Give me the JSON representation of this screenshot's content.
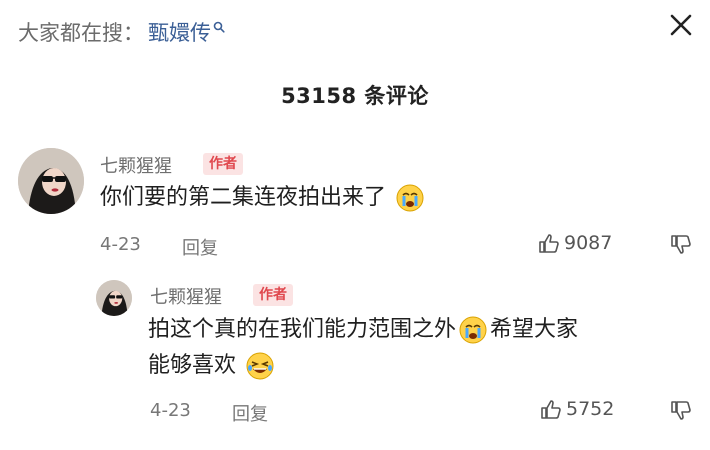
{
  "search": {
    "prefix": "大家都在搜：",
    "term": "甄嬛传"
  },
  "comment_count": "53158 条评论",
  "comments": [
    {
      "username": "七颗猩猩",
      "badge": "作者",
      "text_before_emoji": "你们要的第二集连夜拍出来了",
      "emoji": "crying-emoji",
      "date": "4-23",
      "reply_label": "回复",
      "likes": "9087"
    },
    {
      "username": "七颗猩猩",
      "badge": "作者",
      "text_line1_a": "拍这个真的在我们能力范围之外",
      "text_line1_b": "希望大家",
      "text_line2": "能够喜欢",
      "emoji1": "crying-emoji",
      "emoji2": "laugh-tears-emoji",
      "date": "4-23",
      "reply_label": "回复",
      "likes": "5752"
    }
  ],
  "colors": {
    "accent_link": "#3b5f96",
    "badge_bg": "#fbe3e3",
    "badge_text": "#e0484e"
  }
}
